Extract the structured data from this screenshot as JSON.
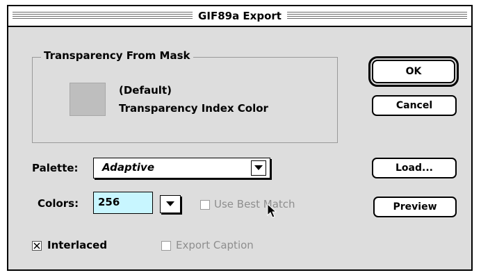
{
  "window": {
    "title": "GIF89a Export"
  },
  "transparency": {
    "group_title": "Transparency From Mask",
    "swatch_color": "#bebebe",
    "line1": "(Default)",
    "line2": "Transparency Index Color"
  },
  "buttons": {
    "ok": "OK",
    "cancel": "Cancel",
    "load": "Load...",
    "preview": "Preview"
  },
  "palette": {
    "label": "Palette:",
    "value": "Adaptive"
  },
  "colors": {
    "label": "Colors:",
    "value": "256"
  },
  "options": {
    "use_best_match": {
      "label": "Use Best Match",
      "checked": false,
      "enabled": false
    },
    "interlaced": {
      "label": "Interlaced",
      "checked": true,
      "enabled": true
    },
    "export_caption": {
      "label": "Export Caption",
      "checked": false,
      "enabled": false
    }
  },
  "icons": {
    "dropdown": "triangle-down",
    "cursor": "arrow-pointer"
  }
}
